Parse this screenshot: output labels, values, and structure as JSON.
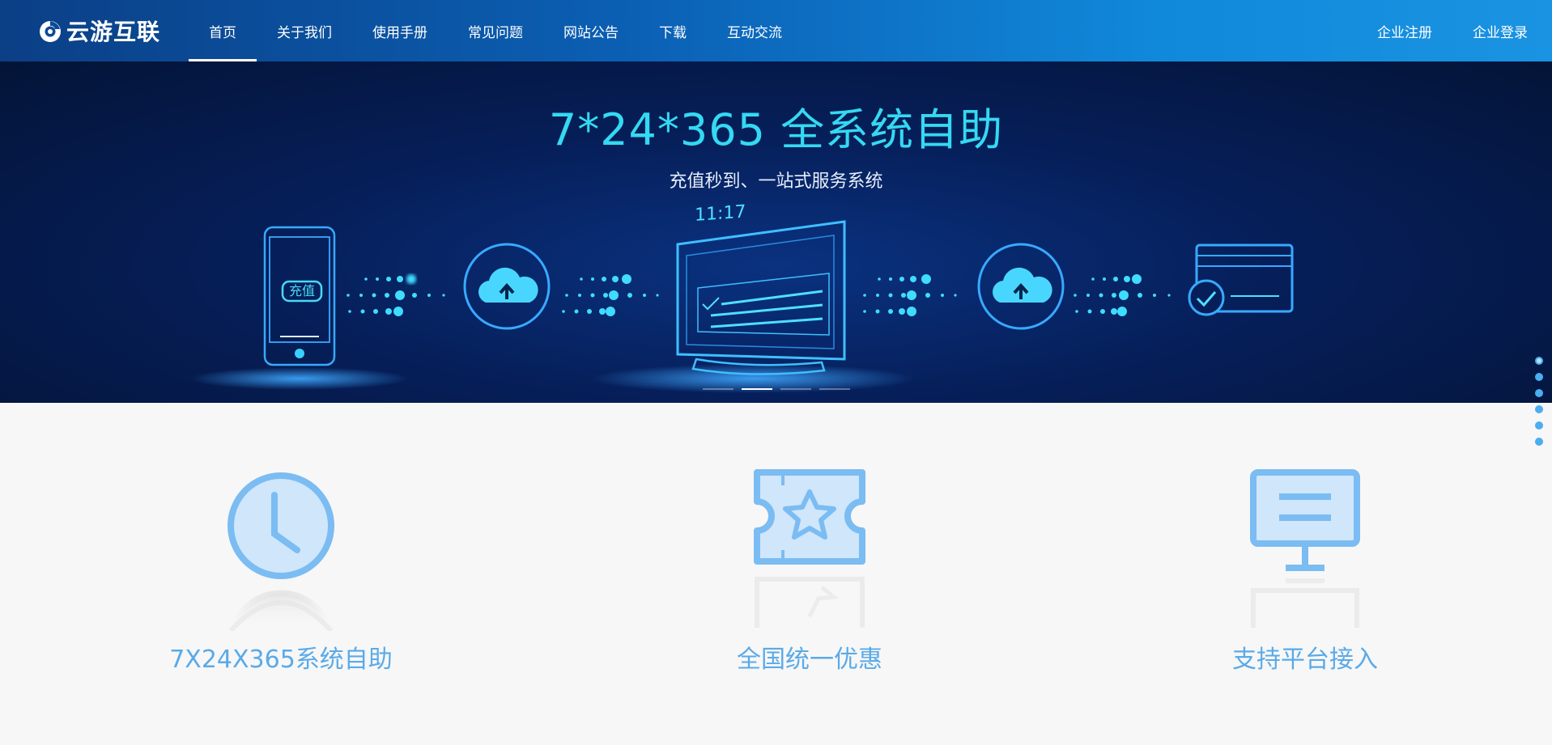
{
  "header": {
    "logo_text": "云游互联",
    "nav": [
      {
        "label": "首页",
        "active": true
      },
      {
        "label": "关于我们"
      },
      {
        "label": "使用手册"
      },
      {
        "label": "常见问题"
      },
      {
        "label": "网站公告"
      },
      {
        "label": "下载"
      },
      {
        "label": "互动交流"
      }
    ],
    "register": "企业注册",
    "login": "企业登录"
  },
  "banner": {
    "title": "7*24*365 全系统自助",
    "subtitle": "充值秒到、一站式服务系统",
    "phone_button": "充值",
    "screen_time": "11:17",
    "slides": 4,
    "active_slide": 1
  },
  "side_pager": {
    "count": 6,
    "active": 0
  },
  "features": [
    {
      "label": "7X24X365系统自助",
      "icon": "clock-icon"
    },
    {
      "label": "全国统一优惠",
      "icon": "ticket-star-icon"
    },
    {
      "label": "支持平台接入",
      "icon": "monitor-icon"
    }
  ],
  "colors": {
    "header_start": "#0b3f86",
    "header_end": "#1a93e2",
    "title_cyan": "#34d9f2",
    "feature_blue": "#5aaae8",
    "icon_light": "#cfe6fb"
  }
}
